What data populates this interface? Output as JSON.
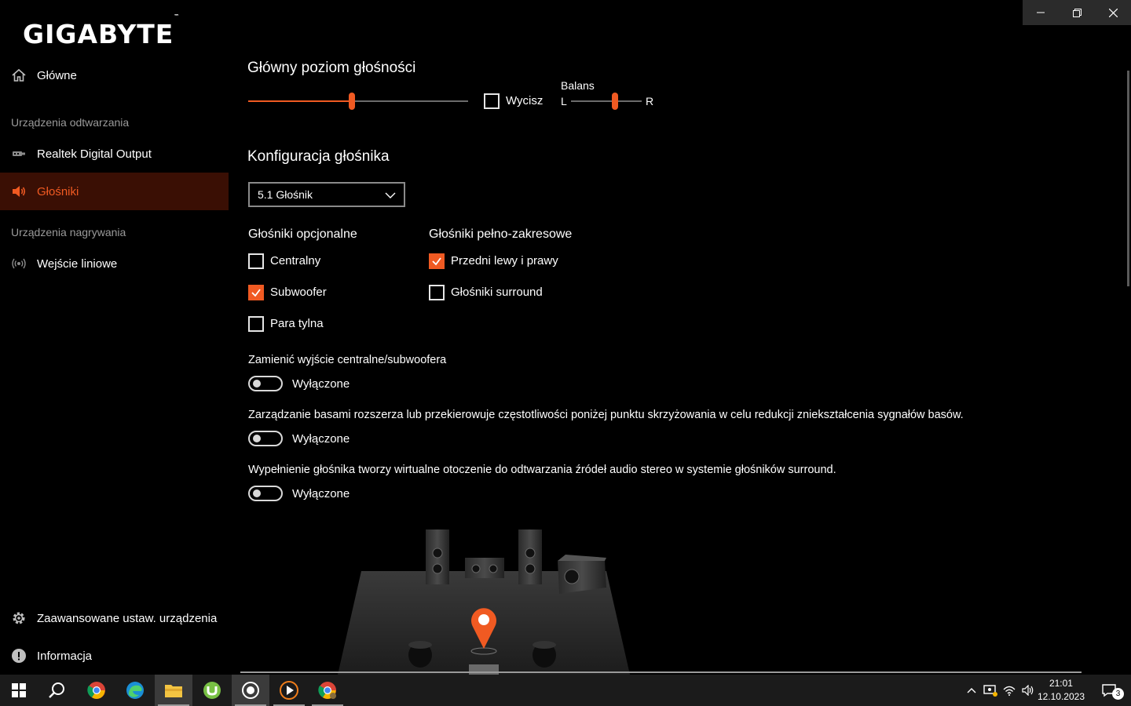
{
  "app": {
    "brand": "GIGABYTE",
    "brand_tm": "™"
  },
  "sidebar": {
    "home": "Główne",
    "playback_section": "Urządzenia odtwarzania",
    "playback_items": [
      "Realtek Digital Output",
      "Głośniki"
    ],
    "recording_section": "Urządzenia nagrywania",
    "recording_items": [
      "Wejście liniowe"
    ],
    "advanced": "Zaawansowane ustaw. urządzenia",
    "info": "Informacja"
  },
  "volume": {
    "title": "Główny poziom głośności",
    "level_fraction": 0.47,
    "mute_label": "Wycisz",
    "mute_checked": false,
    "balance_label": "Balans",
    "balance_left": "L",
    "balance_right": "R",
    "balance_fraction": 0.62
  },
  "speaker_config": {
    "title": "Konfiguracja głośnika",
    "selected": "5.1 Głośnik",
    "optional_title": "Głośniki opcjonalne",
    "optional": [
      {
        "label": "Centralny",
        "checked": false
      },
      {
        "label": "Subwoofer",
        "checked": true
      },
      {
        "label": "Para tylna",
        "checked": false
      }
    ],
    "fullrange_title": "Głośniki pełno-zakresowe",
    "fullrange": [
      {
        "label": "Przedni lewy i prawy",
        "checked": true
      },
      {
        "label": "Głośniki surround",
        "checked": false
      }
    ]
  },
  "options": [
    {
      "desc": "Zamienić wyjście centralne/subwoofera",
      "state": "Wyłączone"
    },
    {
      "desc": "Zarządzanie basami rozszerza lub przekierowuje częstotliwości poniżej punktu skrzyżowania w celu redukcji zniekształcenia sygnałów basów.",
      "state": "Wyłączone"
    },
    {
      "desc": "Wypełnienie głośnika tworzy wirtualne otoczenie do odtwarzania źródeł audio stereo w systemie głośników surround.",
      "state": "Wyłączone"
    }
  ],
  "taskbar": {
    "time": "21:01",
    "date": "12.10.2023",
    "notifications": "3"
  },
  "colors": {
    "accent": "#f05a22",
    "active_bg": "#3a0f04",
    "background": "#000000"
  }
}
